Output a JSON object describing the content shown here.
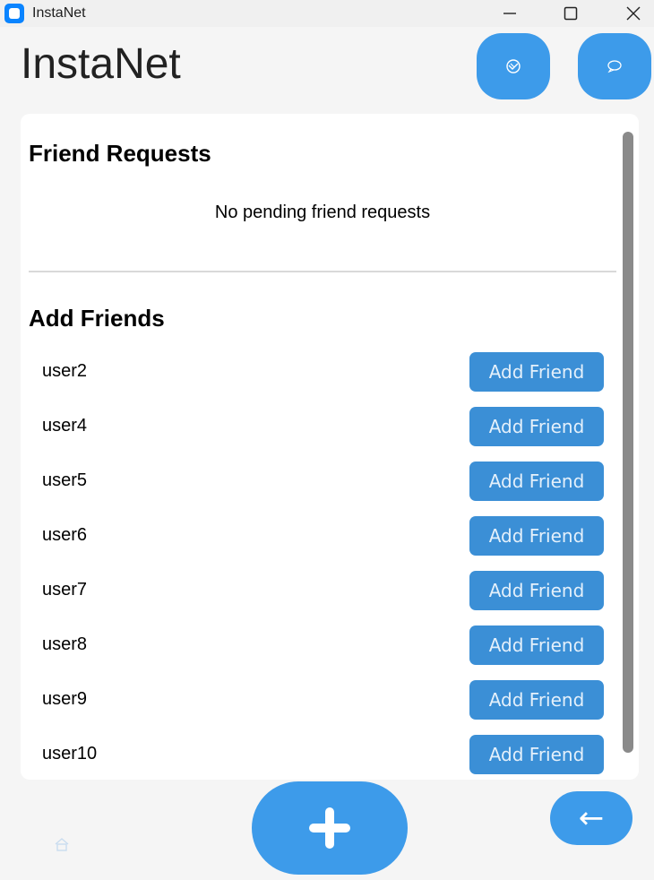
{
  "window": {
    "title": "InstaNet"
  },
  "header": {
    "app_title": "InstaNet"
  },
  "friend_requests": {
    "title": "Friend Requests",
    "empty_message": "No pending friend requests"
  },
  "add_friends": {
    "title": "Add Friends",
    "button_label": "Add Friend",
    "users": [
      {
        "username": "user2",
        "button": "Add Friend"
      },
      {
        "username": "user4",
        "button": "Add Friend"
      },
      {
        "username": "user5",
        "button": "Add Friend"
      },
      {
        "username": "user6",
        "button": "Add Friend"
      },
      {
        "username": "user7",
        "button": "Add Friend"
      },
      {
        "username": "user8",
        "button": "Add Friend"
      },
      {
        "username": "user9",
        "button": "Add Friend"
      },
      {
        "username": "user10",
        "button": "Add Friend"
      }
    ]
  },
  "bottom": {
    "back_label": "←"
  },
  "icons": {
    "header_left": "handshake-icon",
    "header_right": "chat-bubble-icon",
    "fab": "plus-icon",
    "home": "home-icon"
  },
  "colors": {
    "accent": "#3d9bea",
    "add_button": "#3b8fd6",
    "background": "#f5f5f5",
    "card": "#ffffff"
  }
}
